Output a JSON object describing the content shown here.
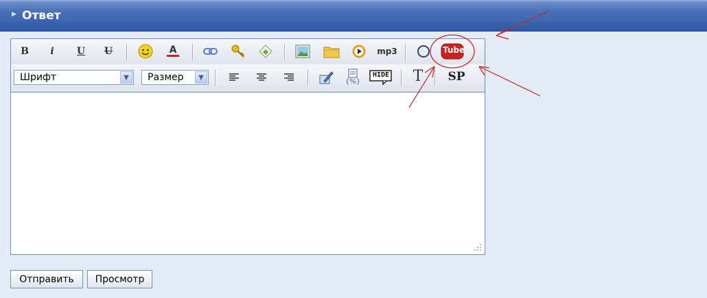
{
  "header": {
    "title": "Ответ"
  },
  "toolbar": {
    "bold": "B",
    "italic": "i",
    "underline": "U",
    "strike": "U",
    "color": "A",
    "mp3": "mp3",
    "youtube": "Tube",
    "hide": "HIDE",
    "text": "T",
    "sp": "SP",
    "font_select": "Шрифт",
    "size_select": "Размер",
    "code_label": "{%}"
  },
  "buttons": {
    "submit": "Отправить",
    "preview": "Просмотр"
  },
  "colors": {
    "header": "#2f5aa6",
    "annotation": "#d22020",
    "youtube": "#d0201e"
  }
}
